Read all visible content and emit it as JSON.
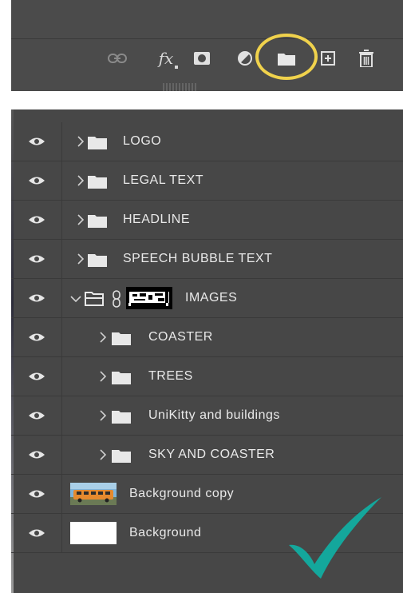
{
  "toolbar": {
    "icons": [
      {
        "name": "link-icon"
      },
      {
        "name": "fx-icon",
        "text": "fx"
      },
      {
        "name": "mask-icon"
      },
      {
        "name": "adjustment-icon"
      },
      {
        "name": "new-group-folder-icon"
      },
      {
        "name": "new-layer-icon"
      },
      {
        "name": "trash-icon"
      }
    ],
    "highlight_color": "#f0d24c"
  },
  "layers": {
    "rows": [
      {
        "label": "LOGO",
        "type": "group",
        "depth": 0,
        "expanded": false
      },
      {
        "label": "LEGAL TEXT",
        "type": "group",
        "depth": 0,
        "expanded": false
      },
      {
        "label": "HEADLINE",
        "type": "group",
        "depth": 0,
        "expanded": false
      },
      {
        "label": "SPEECH BUBBLE TEXT",
        "type": "group",
        "depth": 0,
        "expanded": false
      },
      {
        "label": "IMAGES",
        "type": "group",
        "depth": 0,
        "expanded": true,
        "linked_mask": true
      },
      {
        "label": "COASTER",
        "type": "group",
        "depth": 1,
        "expanded": false
      },
      {
        "label": "TREES",
        "type": "group",
        "depth": 1,
        "expanded": false
      },
      {
        "label": "UniKitty and buildings",
        "type": "group",
        "depth": 1,
        "expanded": false
      },
      {
        "label": "SKY AND COASTER",
        "type": "group",
        "depth": 1,
        "expanded": false
      },
      {
        "label": "Background copy",
        "type": "image-layer"
      },
      {
        "label": "Background",
        "type": "white-layer"
      }
    ]
  },
  "colors": {
    "panel_bg": "#474747",
    "text": "#e9e9e9",
    "checkmark": "#14a79c"
  }
}
